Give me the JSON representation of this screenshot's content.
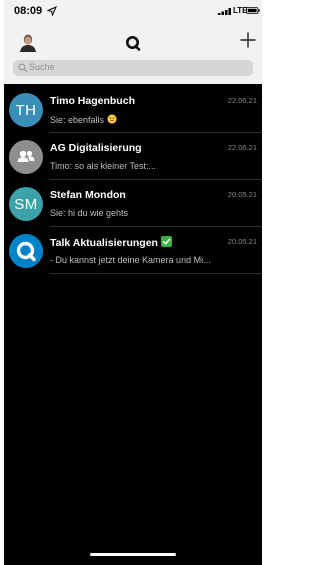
{
  "status_bar": {
    "time": "08:09",
    "network": "LTE"
  },
  "header": {
    "logo_icon": "app-logo-q",
    "add_icon": "plus-icon"
  },
  "search": {
    "placeholder": "Suche"
  },
  "chats": [
    {
      "name": "Timo Hagenbuch",
      "initials": "TH",
      "avatar_color": "#3a8fb7",
      "preview": "Sie: ebenfalls",
      "preview_emoji": "slightly-smiling-face",
      "date": "22.06.21"
    },
    {
      "name": "AG Digitalisierung",
      "avatar_icon": "group-icon",
      "avatar_color": "#8e8e8e",
      "preview": "Timo: so als kleiner Test:...",
      "date": "22.06.21"
    },
    {
      "name": "Stefan Mondon",
      "initials": "SM",
      "avatar_color": "#3aa2a8",
      "preview": "Sie: hi du wie gehts",
      "date": "20.05.21"
    },
    {
      "name": "Talk Aktualisierungen",
      "name_emoji": "check-mark-button",
      "avatar_icon": "talk-logo",
      "avatar_color": "#0082c9",
      "preview": "- Du kannst jetzt deine Kamera und Mi...",
      "date": "20.05.21"
    }
  ]
}
